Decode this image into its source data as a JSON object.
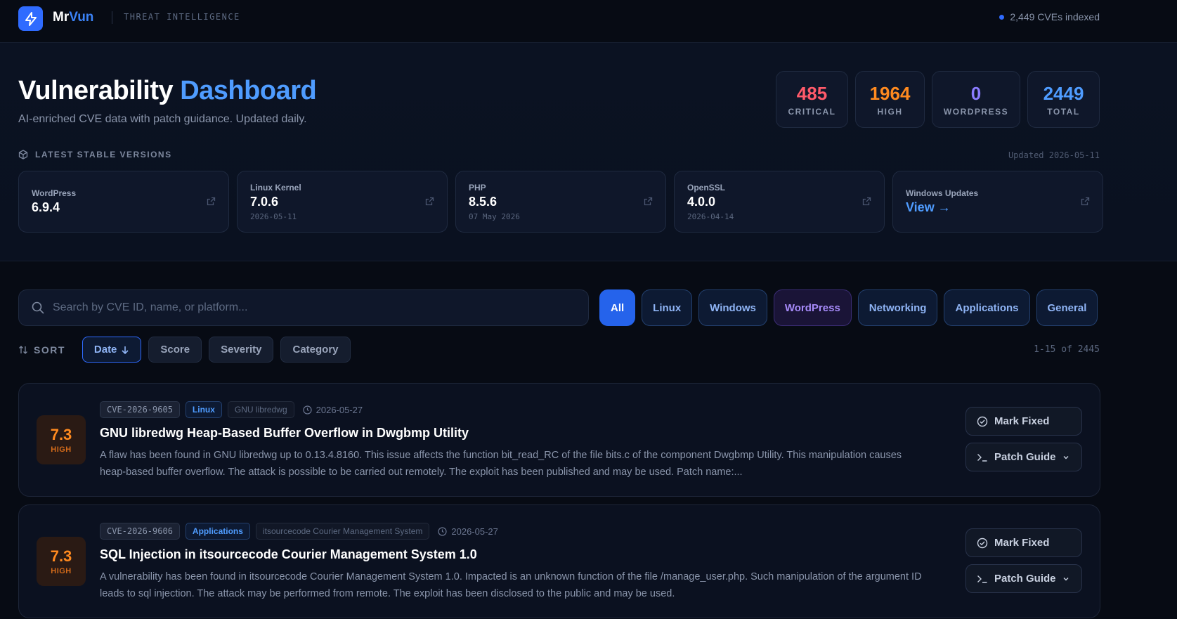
{
  "header": {
    "brand_prefix": "Mr",
    "brand_accent": "Vun",
    "tagline": "THREAT INTELLIGENCE",
    "indexed": "2,449 CVEs indexed"
  },
  "hero": {
    "title_main": "Vulnerability",
    "title_accent": "Dashboard",
    "subtitle": "AI-enriched CVE data with patch guidance. Updated daily."
  },
  "stats": [
    {
      "value": "485",
      "label": "CRITICAL",
      "color": "#ff5a6a"
    },
    {
      "value": "1964",
      "label": "HIGH",
      "color": "#ff8a1f"
    },
    {
      "value": "0",
      "label": "WORDPRESS",
      "color": "#8b7cff"
    },
    {
      "value": "2449",
      "label": "TOTAL",
      "color": "#4f9cff"
    }
  ],
  "versions": {
    "heading": "LATEST STABLE VERSIONS",
    "updated": "Updated 2026-05-11",
    "items": [
      {
        "name": "WordPress",
        "version": "6.9.4",
        "date": ""
      },
      {
        "name": "Linux Kernel",
        "version": "7.0.6",
        "date": "2026-05-11"
      },
      {
        "name": "PHP",
        "version": "8.5.6",
        "date": "07 May 2026"
      },
      {
        "name": "OpenSSL",
        "version": "4.0.0",
        "date": "2026-04-14"
      },
      {
        "name": "Windows Updates",
        "version": "View →",
        "date": ""
      }
    ]
  },
  "search": {
    "placeholder": "Search by CVE ID, name, or platform..."
  },
  "filters": [
    "All",
    "Linux",
    "Windows",
    "WordPress",
    "Networking",
    "Applications",
    "General"
  ],
  "sort": {
    "label": "SORT",
    "options": [
      "Date",
      "Score",
      "Severity",
      "Category"
    ],
    "paging": "1-15 of 2445"
  },
  "cves": [
    {
      "score": "7.3",
      "severity": "HIGH",
      "id": "CVE-2026-9605",
      "category": "Linux",
      "product": "GNU libredwg",
      "date": "2026-05-27",
      "title": "GNU libredwg Heap-Based Buffer Overflow in Dwgbmp Utility",
      "description": "A flaw has been found in GNU libredwg up to 0.13.4.8160. This issue affects the function bit_read_RC of the file bits.c of the component Dwgbmp Utility. This manipulation causes heap-based buffer overflow. The attack is possible to be carried out remotely. The exploit has been published and may be used. Patch name:...",
      "mark_fixed": "Mark Fixed",
      "patch_guide": "Patch Guide"
    },
    {
      "score": "7.3",
      "severity": "HIGH",
      "id": "CVE-2026-9606",
      "category": "Applications",
      "product": "itsourcecode Courier Management System",
      "date": "2026-05-27",
      "title": "SQL Injection in itsourcecode Courier Management System 1.0",
      "description": "A vulnerability has been found in itsourcecode Courier Management System 1.0. Impacted is an unknown function of the file /manage_user.php. Such manipulation of the argument ID leads to sql injection. The attack may be performed from remote. The exploit has been disclosed to the public and may be used.",
      "mark_fixed": "Mark Fixed",
      "patch_guide": "Patch Guide"
    }
  ]
}
